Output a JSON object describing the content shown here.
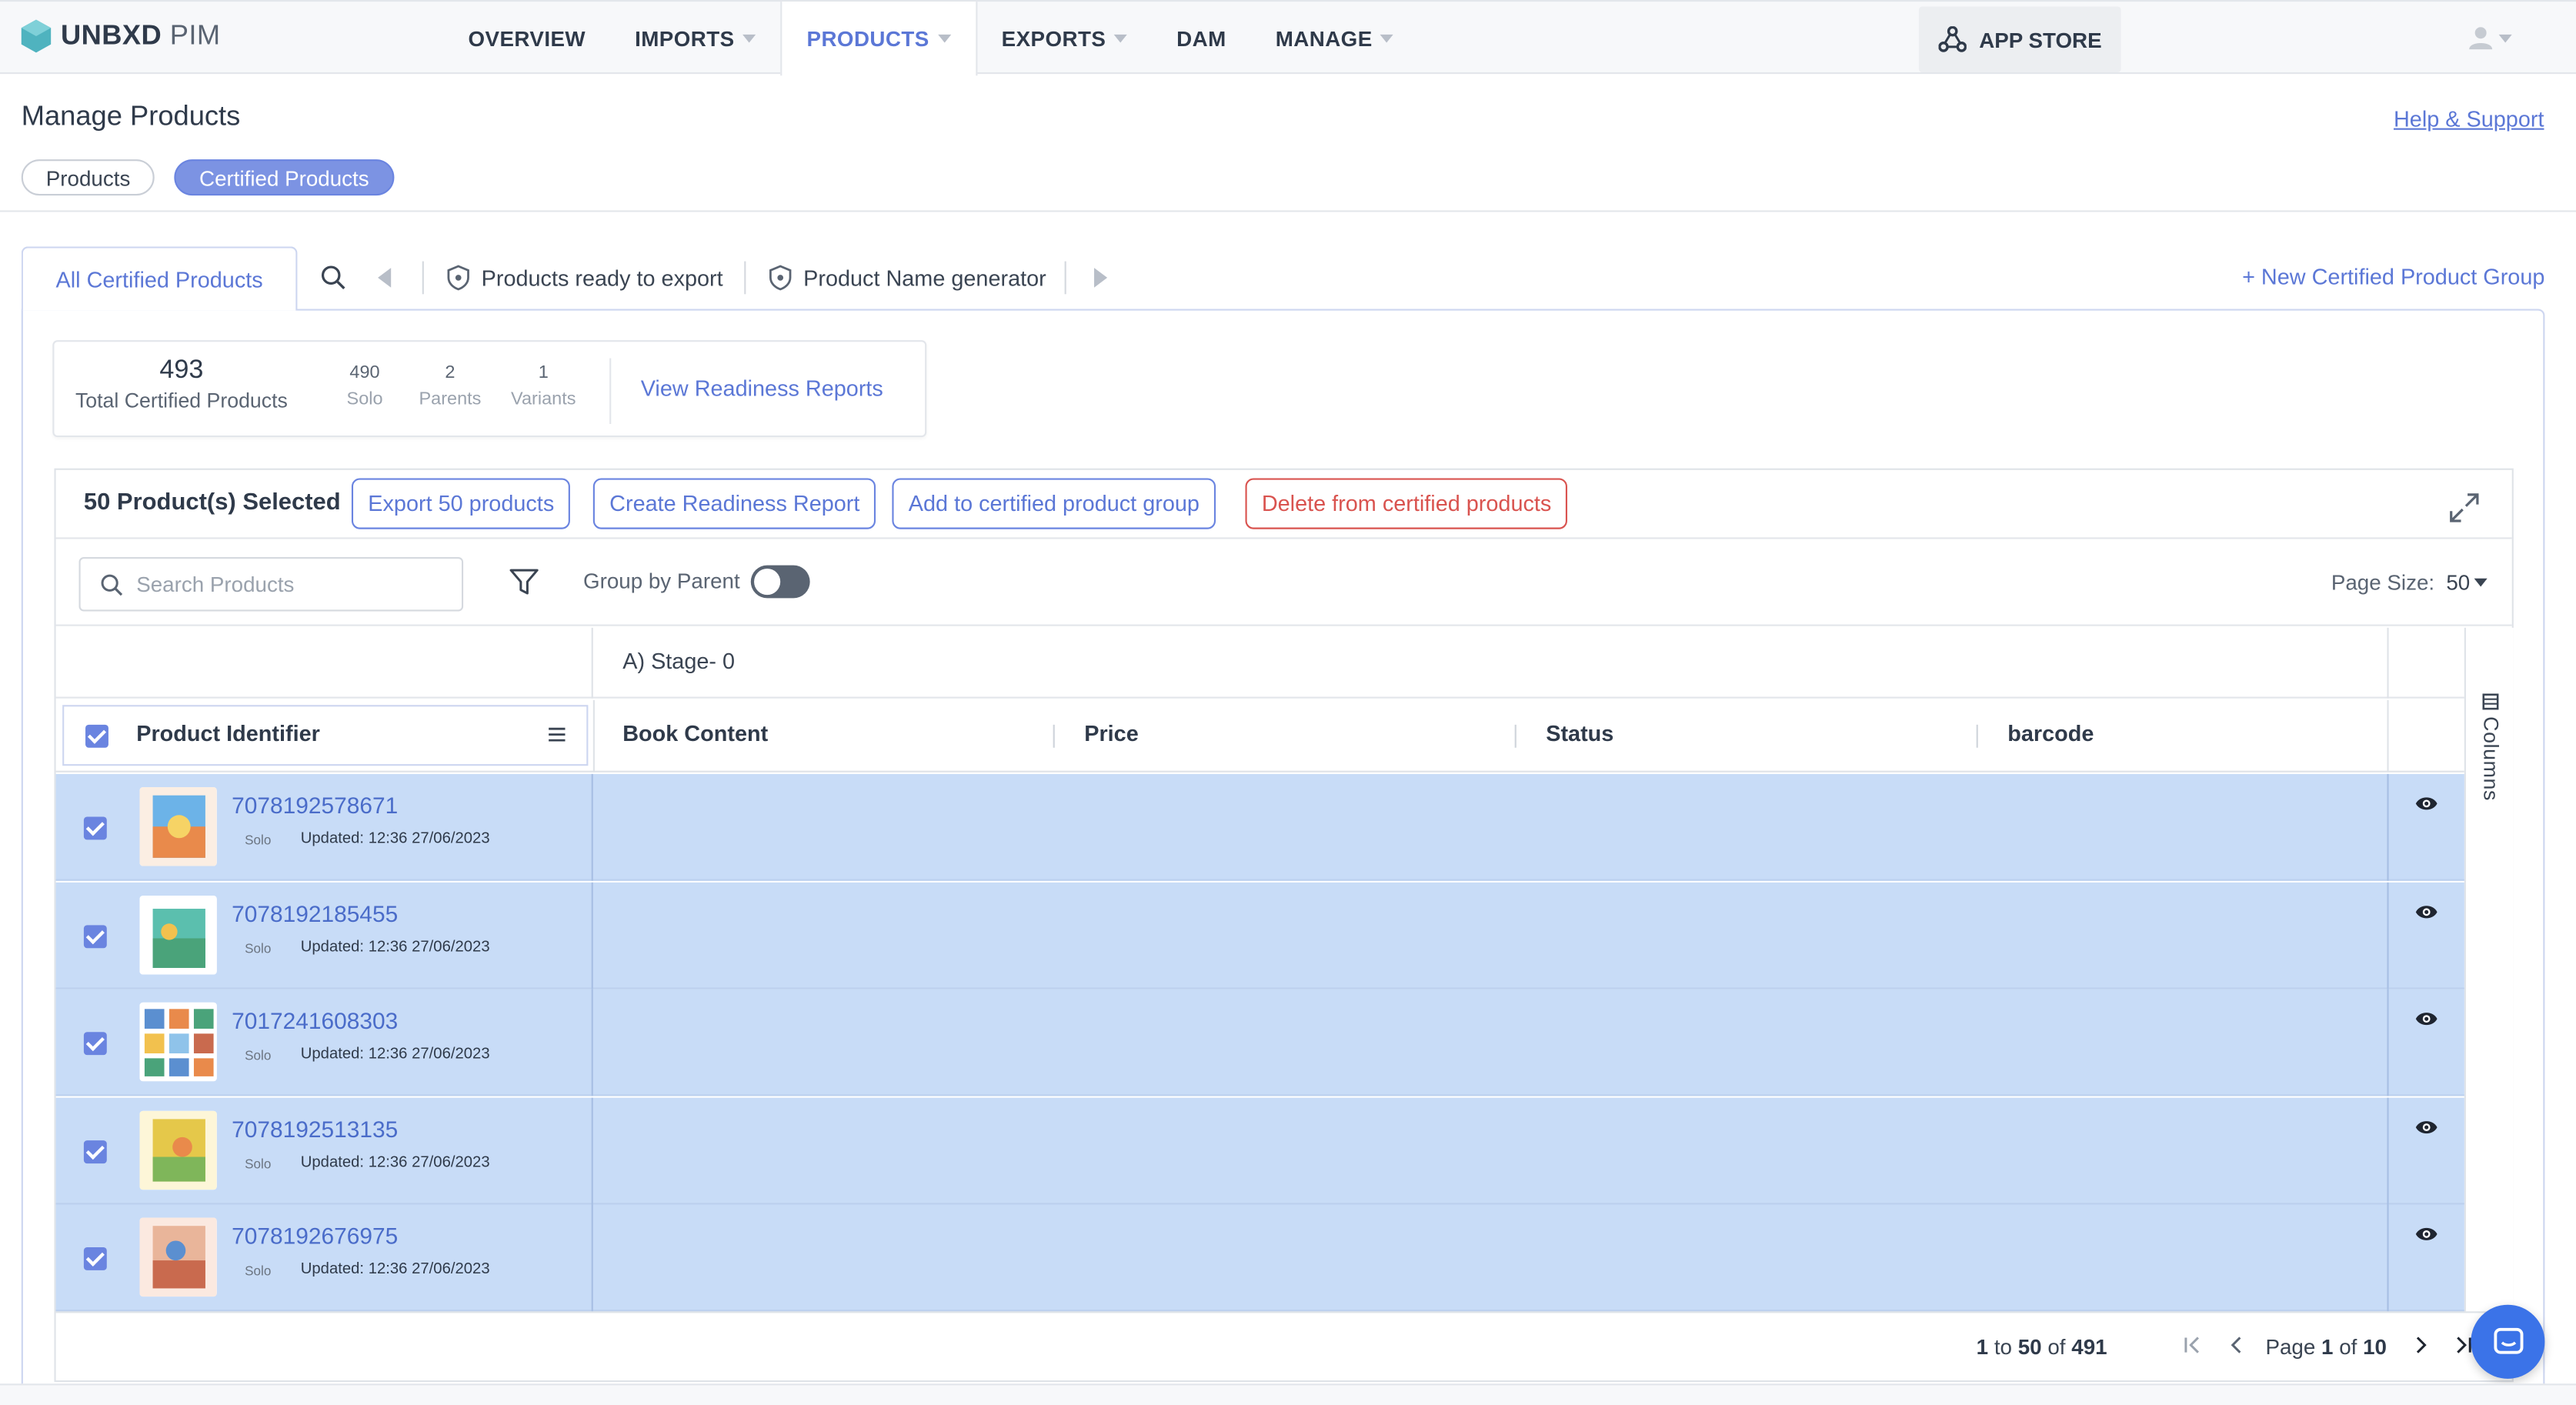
{
  "brand": {
    "name_bold": "UNBXD",
    "name_light": " PIM"
  },
  "nav": {
    "items": [
      {
        "label": "OVERVIEW",
        "has_caret": false
      },
      {
        "label": "IMPORTS",
        "has_caret": true
      },
      {
        "label": "PRODUCTS",
        "has_caret": true,
        "active": true
      },
      {
        "label": "EXPORTS",
        "has_caret": true
      },
      {
        "label": "DAM",
        "has_caret": false
      },
      {
        "label": "MANAGE",
        "has_caret": true
      }
    ],
    "app_store": "APP STORE"
  },
  "page": {
    "title": "Manage Products",
    "help_link": "Help & Support",
    "tabs": [
      "Products",
      "Certified Products"
    ]
  },
  "groups": {
    "active_tab": "All Certified Products",
    "items": [
      "Products ready to export",
      "Product Name generator"
    ],
    "new_group": "+ New Certified Product Group"
  },
  "stats": {
    "total": "493",
    "total_label": "Total Certified Products",
    "breakdown": [
      {
        "num": "490",
        "label": "Solo"
      },
      {
        "num": "2",
        "label": "Parents"
      },
      {
        "num": "1",
        "label": "Variants"
      }
    ],
    "view_reports": "View Readiness Reports"
  },
  "selection": {
    "count_label": "50 Product(s) Selected",
    "actions": [
      {
        "label": "Export 50 products",
        "style": "primary"
      },
      {
        "label": "Create Readiness Report",
        "style": "primary"
      },
      {
        "label": "Add to certified product group",
        "style": "primary"
      },
      {
        "label": "Delete from certified products",
        "style": "danger"
      }
    ]
  },
  "toolbar": {
    "search_placeholder": "Search Products",
    "group_by_parent": "Group by Parent",
    "group_by_parent_on": false,
    "page_size_label": "Page Size:",
    "page_size_value": "50"
  },
  "table": {
    "group_header": "A) Stage- 0",
    "pinned_header": "Product Identifier",
    "columns": [
      "Book Content",
      "Price",
      "Status",
      "barcode"
    ],
    "columns_panel": "Columns",
    "rows": [
      {
        "id": "7078192578671",
        "kind": "Solo",
        "updated": "Updated: 12:36 27/06/2023",
        "thumb_color": "#e98a4b"
      },
      {
        "id": "7078192185455",
        "kind": "Solo",
        "updated": "Updated: 12:36 27/06/2023",
        "thumb_color": "#4aa37a"
      },
      {
        "id": "7017241608303",
        "kind": "Solo",
        "updated": "Updated: 12:36 27/06/2023",
        "thumb_color": "#5b8fd0"
      },
      {
        "id": "7078192513135",
        "kind": "Solo",
        "updated": "Updated: 12:36 27/06/2023",
        "thumb_color": "#e5c84a"
      },
      {
        "id": "7078192676975",
        "kind": "Solo",
        "updated": "Updated: 12:36 27/06/2023",
        "thumb_color": "#c96a4e"
      }
    ]
  },
  "pagination": {
    "from": "1",
    "to_word": "to",
    "to": "50",
    "of_word": "of",
    "total": "491",
    "page_word": "Page",
    "page": "1",
    "page_of": "of",
    "pages": "10"
  },
  "colors": {
    "accent": "#5b77d6",
    "row_selected": "#c8dcf7",
    "danger": "#d9534f"
  }
}
